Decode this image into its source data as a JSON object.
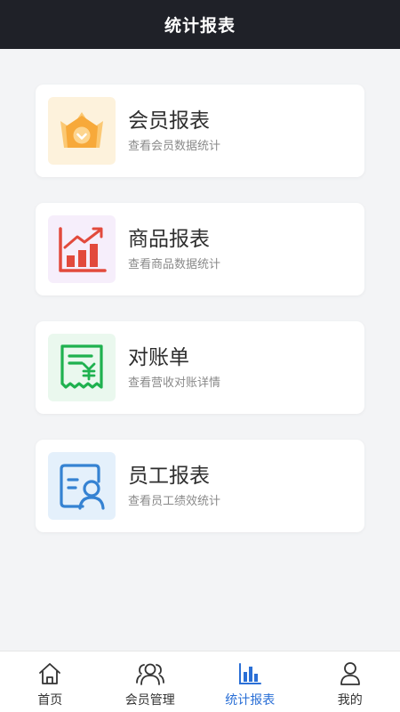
{
  "header": {
    "title": "统计报表"
  },
  "cards": [
    {
      "title": "会员报表",
      "subtitle": "查看会员数据统计",
      "icon": "crown-icon",
      "bg": "#fdf2dc",
      "color": "#f7a93a"
    },
    {
      "title": "商品报表",
      "subtitle": "查看商品数据统计",
      "icon": "bar-chart-trend-icon",
      "bg": "#f6eefb",
      "color": "#e24a3c"
    },
    {
      "title": "对账单",
      "subtitle": "查看营收对账详情",
      "icon": "receipt-yen-icon",
      "bg": "#eaf8ee",
      "color": "#1fb14f"
    },
    {
      "title": "员工报表",
      "subtitle": "查看员工绩效统计",
      "icon": "employee-card-icon",
      "bg": "#e4f0fb",
      "color": "#3582d2"
    }
  ],
  "tabbar": {
    "items": [
      {
        "label": "首页",
        "icon": "home-icon",
        "active": false
      },
      {
        "label": "会员管理",
        "icon": "members-icon",
        "active": false
      },
      {
        "label": "统计报表",
        "icon": "statistics-icon",
        "active": true
      },
      {
        "label": "我的",
        "icon": "profile-icon",
        "active": false
      }
    ],
    "active_color": "#2a6fd6"
  }
}
